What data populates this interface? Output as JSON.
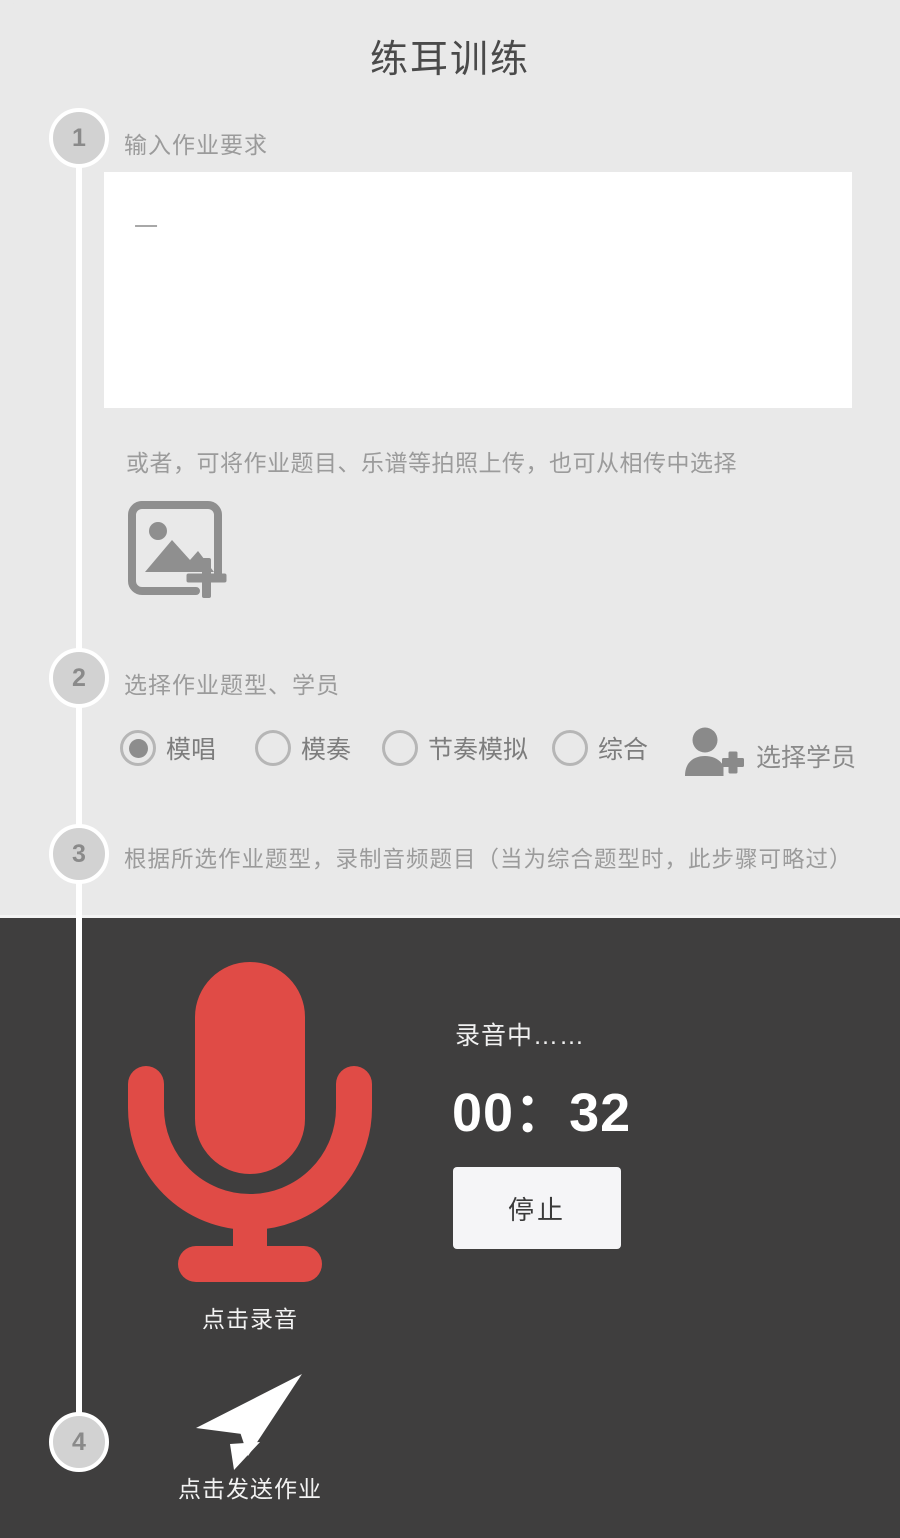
{
  "header": {
    "title": "练耳训练"
  },
  "theme": {
    "light_bg": "#e9e9e9",
    "dark_bg": "#3f3e3e",
    "accent_red": "#e04b46",
    "step_circle": "#d2d2d2",
    "muted_text": "#9b9b9b"
  },
  "steps": [
    {
      "number": "1",
      "label": "输入作业要求"
    },
    {
      "number": "2",
      "label": "选择作业题型、学员"
    },
    {
      "number": "3",
      "label": "根据所选作业题型，录制音频题目（当为综合题型时，此步骤可略过）"
    },
    {
      "number": "4",
      "label": ""
    }
  ],
  "step1": {
    "textarea_value": "一",
    "textarea_placeholder": "",
    "upload_hint": "或者，可将作业题目、乐谱等拍照上传，也可从相传中选择",
    "upload_icon": "add-image-icon"
  },
  "step2": {
    "options": [
      {
        "label": "模唱",
        "selected": true
      },
      {
        "label": "模奏",
        "selected": false
      },
      {
        "label": "节奏模拟",
        "selected": false
      },
      {
        "label": "综合",
        "selected": false
      }
    ],
    "student_picker": {
      "label": "选择学员",
      "icon": "add-person-icon"
    }
  },
  "step3": {
    "mic_icon": "microphone-icon",
    "mic_caption": "点击录音",
    "status_text": "录音中……",
    "timer": "00：32",
    "stop_label": "停止"
  },
  "step4": {
    "send_icon": "paper-plane-icon",
    "send_caption": "点击发送作业"
  }
}
